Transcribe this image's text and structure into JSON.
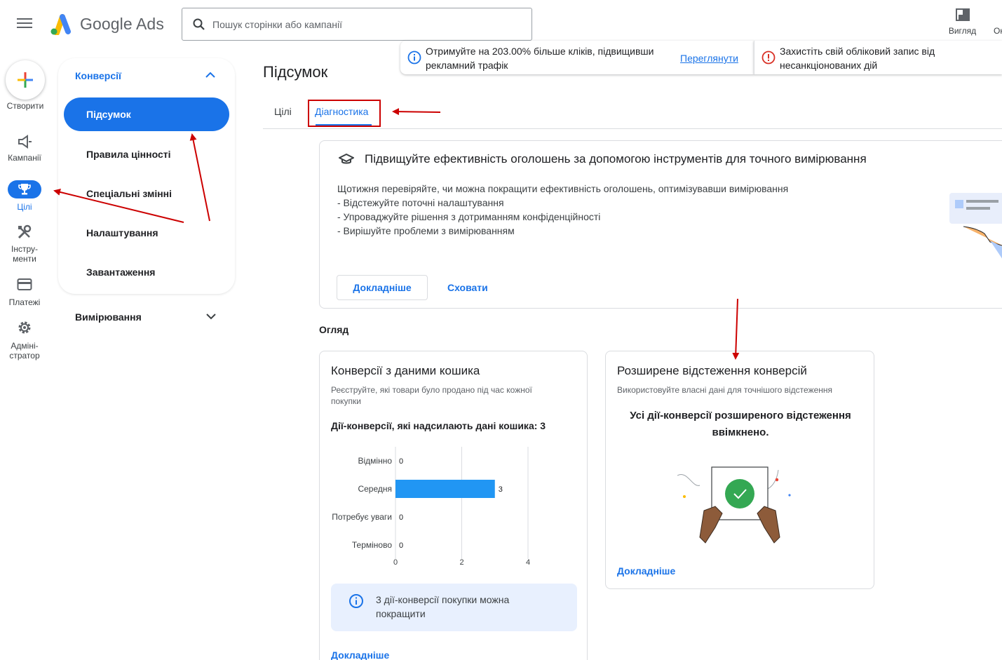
{
  "app": {
    "name": "Google Ads"
  },
  "search": {
    "placeholder": "Пошук сторінки або кампанії"
  },
  "topbar": {
    "view_label": "Вигляд",
    "cut_label": "Он"
  },
  "notices": [
    {
      "text": "Отримуйте на 203.00% більше кліків, підвищивши рекламний трафік",
      "action": "Переглянути"
    },
    {
      "text": "Захистіть свій обліковий запис від несанкціонованих дій"
    }
  ],
  "rail": {
    "create": "Створити",
    "campaigns": "Кампанії",
    "goals": "Цілі",
    "tools_line1": "Інстру-",
    "tools_line2": "менти",
    "billing": "Платежі",
    "admin_line1": "Адміні-",
    "admin_line2": "стратор"
  },
  "nav": {
    "section": "Конверсії",
    "items": [
      "Підсумок",
      "Правила цінності",
      "Спеціальні змінні",
      "Налаштування",
      "Завантаження"
    ],
    "collapsed_section": "Вимірювання"
  },
  "main": {
    "title": "Підсумок",
    "tabs": [
      "Цілі",
      "Діагностика"
    ],
    "promo": {
      "title": "Підвищуйте ефективність оголошень за допомогою інструментів для точного вимірювання",
      "lines": [
        "Щотижня перевіряйте, чи можна покращити ефективність оголошень, оптимізувавши вимірювання",
        "- Відстежуйте поточні налаштування",
        "- Упроваджуйте рішення з дотриманням конфіденційності",
        "- Вирішуйте проблеми з вимірюванням"
      ],
      "learn_more": "Докладніше",
      "hide": "Сховати"
    },
    "overview_label": "Огляд",
    "cart_card": {
      "title": "Конверсії з даними кошика",
      "subtitle": "Реєструйте, які товари було продано під час кожної покупки",
      "count_text": "Дії-конверсії, які надсилають дані кошика: 3",
      "info_text": "3 дії-конверсії покупки можна покращити",
      "learn_more": "Докладніше"
    },
    "enhanced_card": {
      "title": "Розширене відстеження конверсій",
      "subtitle": "Використовуйте власні дані для точнішого відстеження",
      "status": "Усі дії-конверсії розширеного відстеження ввімкнено.",
      "learn_more": "Докладніше"
    }
  },
  "chart_data": {
    "type": "bar",
    "orientation": "horizontal",
    "categories": [
      "Відмінно",
      "Середня",
      "Потребує уваги",
      "Терміново"
    ],
    "values": [
      0,
      3,
      0,
      0
    ],
    "data_labels": [
      "0",
      "3",
      "0",
      "0"
    ],
    "xticks": [
      "0",
      "2",
      "4"
    ],
    "xlim": [
      0,
      4
    ],
    "bar_color": "#2196f3"
  },
  "colors": {
    "accent": "#1a73e8",
    "annotation": "#cc0000"
  }
}
